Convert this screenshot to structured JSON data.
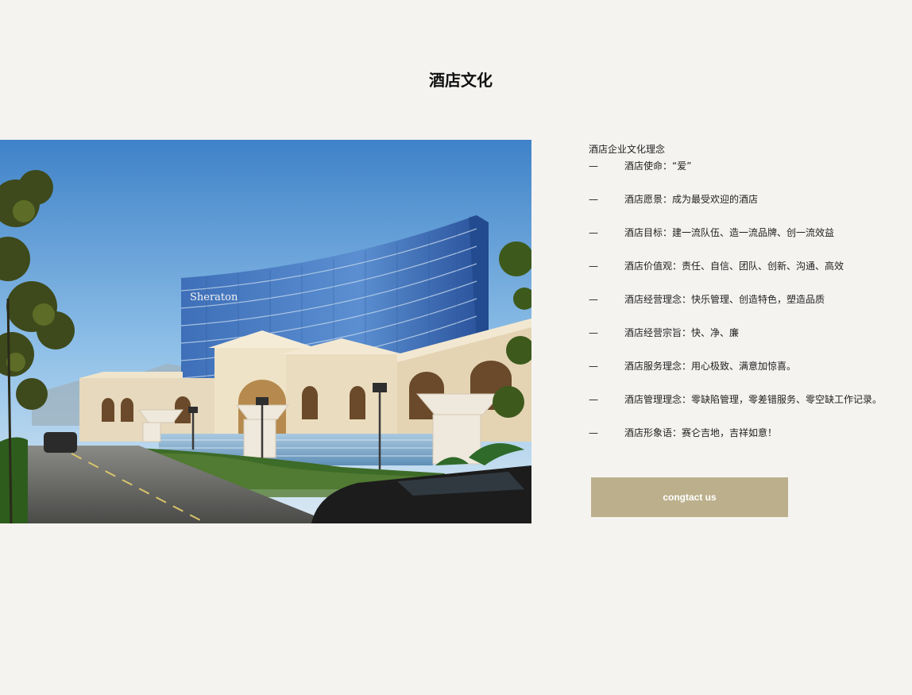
{
  "page": {
    "title": "酒店文化"
  },
  "hero": {
    "sign_text": "Sheraton"
  },
  "culture": {
    "heading": "酒店企业文化理念",
    "dash": "—",
    "items": [
      {
        "label": "酒店使命：“爱”"
      },
      {
        "label": "酒店愿景：成为最受欢迎的酒店"
      },
      {
        "label": "酒店目标：建一流队伍、造一流品牌、创一流效益"
      },
      {
        "label": "酒店价值观：责任、自信、团队、创新、沟通、高效"
      },
      {
        "label": "酒店经营理念：快乐管理、创造特色，塑造品质"
      },
      {
        "label": "酒店经营宗旨：快、净、廉"
      },
      {
        "label": "酒店服务理念：用心极致、满意加惊喜。"
      },
      {
        "label": "酒店管理理念：零缺陷管理，零差错服务、零空缺工作记录。"
      },
      {
        "label": "酒店形象语：赛仑吉地，吉祥如意！"
      }
    ]
  },
  "contact_button": {
    "label": "congtact us"
  },
  "colors": {
    "background": "#f4f3f0",
    "button": "#bcb08c",
    "button_text": "#ffffff"
  }
}
